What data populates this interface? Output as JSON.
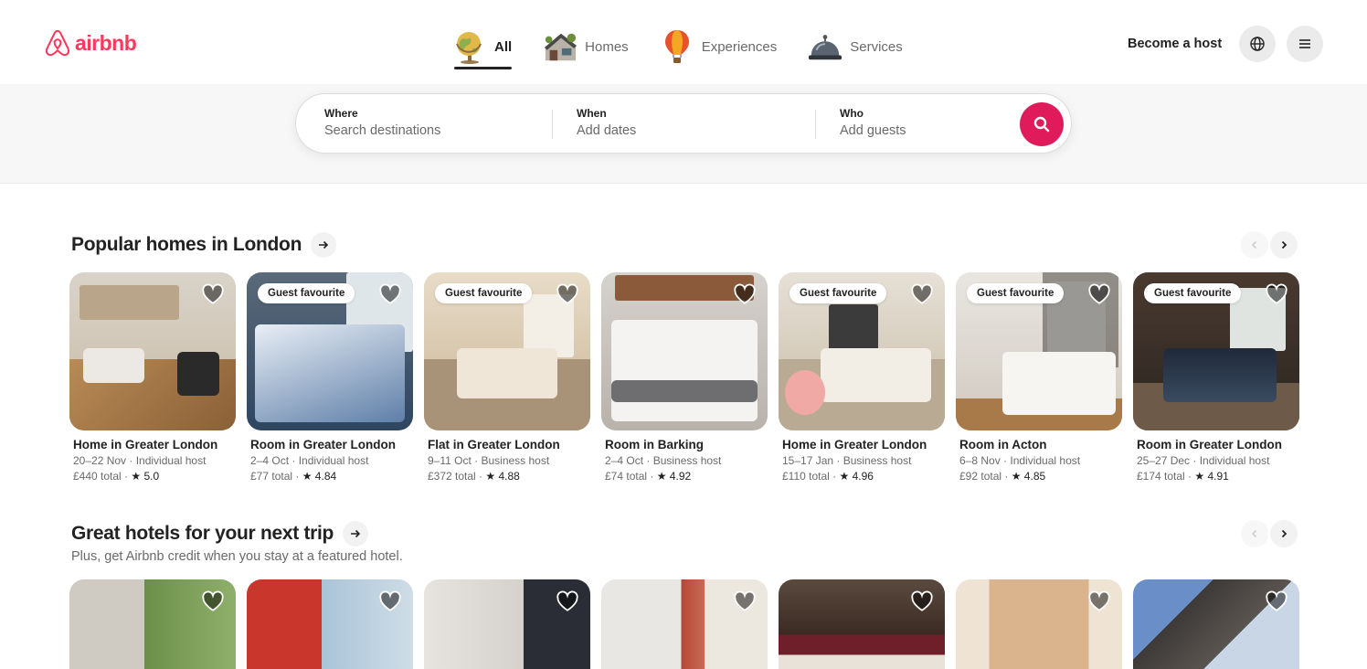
{
  "brand": {
    "name": "airbnb",
    "color": "#ff385c"
  },
  "categories": [
    {
      "label": "All",
      "icon": "globe-icon",
      "active": true
    },
    {
      "label": "Homes",
      "icon": "house-icon",
      "active": false
    },
    {
      "label": "Experiences",
      "icon": "hot-air-balloon-icon",
      "active": false
    },
    {
      "label": "Services",
      "icon": "service-bell-icon",
      "active": false
    }
  ],
  "header": {
    "host_label": "Become a host",
    "globe_icon": "globe-outline-icon",
    "menu_icon": "hamburger-menu-icon"
  },
  "search": {
    "where_label": "Where",
    "where_placeholder": "Search destinations",
    "when_label": "When",
    "when_placeholder": "Add dates",
    "who_label": "Who",
    "who_placeholder": "Add guests",
    "button_color": "#e01b5b"
  },
  "popular": {
    "title": "Popular homes in London",
    "listings": [
      {
        "badge": "",
        "title": "Home in Greater London",
        "dates_host": "20–22 Nov · Individual host",
        "price": "£440 total",
        "rating": "★ 5.0"
      },
      {
        "badge": "Guest favourite",
        "title": "Room in Greater London",
        "dates_host": "2–4 Oct · Individual host",
        "price": "£77 total",
        "rating": "★ 4.84"
      },
      {
        "badge": "Guest favourite",
        "title": "Flat in Greater London",
        "dates_host": "9–11 Oct · Business host",
        "price": "£372 total",
        "rating": "★ 4.88"
      },
      {
        "badge": "",
        "title": "Room in Barking",
        "dates_host": "2–4 Oct · Business host",
        "price": "£74 total",
        "rating": "★ 4.92"
      },
      {
        "badge": "Guest favourite",
        "title": "Home in Greater London",
        "dates_host": "15–17 Jan · Business host",
        "price": "£110 total",
        "rating": "★ 4.96"
      },
      {
        "badge": "Guest favourite",
        "title": "Room in Acton",
        "dates_host": "6–8 Nov · Individual host",
        "price": "£92 total",
        "rating": "★ 4.85"
      },
      {
        "badge": "Guest favourite",
        "title": "Room in Greater London",
        "dates_host": "25–27 Dec · Individual host",
        "price": "£174 total",
        "rating": "★ 4.91"
      }
    ]
  },
  "hotels": {
    "title": "Great hotels for your next trip",
    "subtitle": "Plus, get Airbnb credit when you stay at a featured hotel."
  }
}
